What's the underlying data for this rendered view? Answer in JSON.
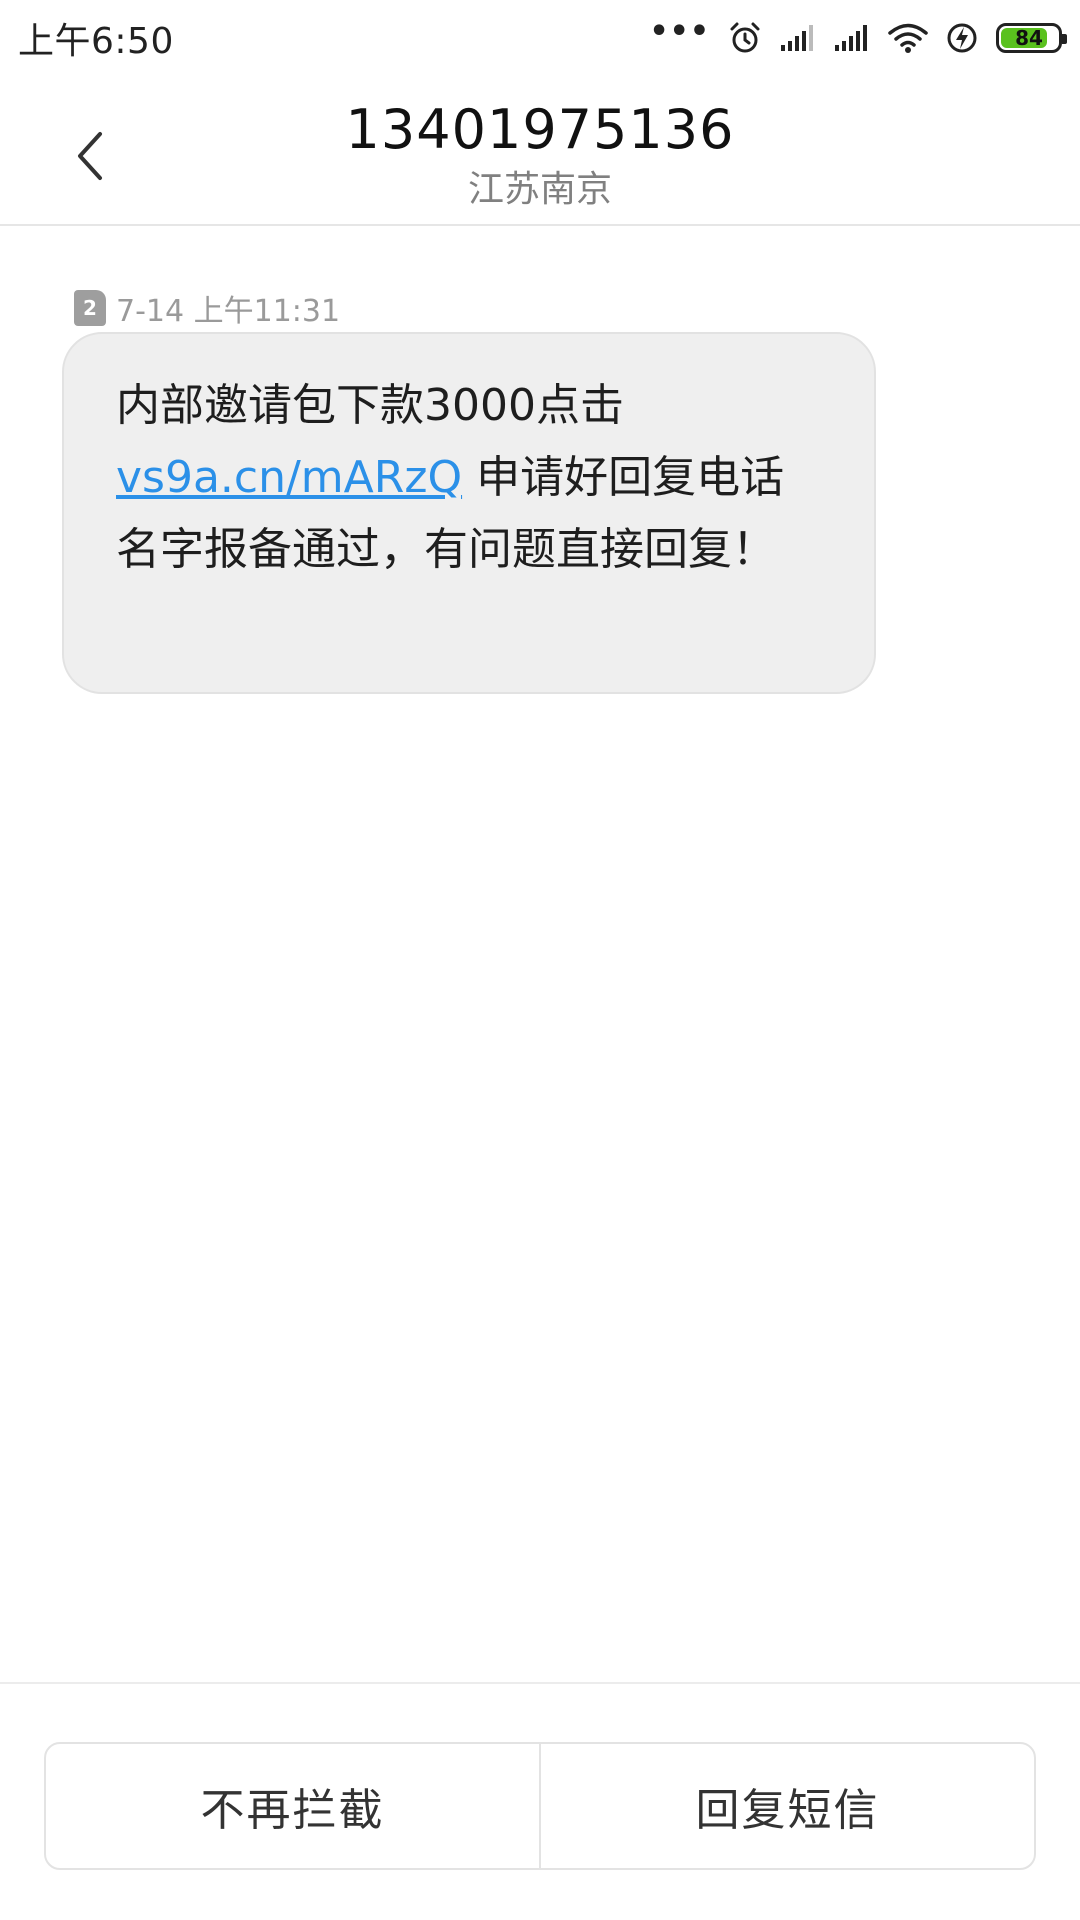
{
  "status_bar": {
    "time": "上午6:50",
    "battery_level": "84",
    "battery_color": "#5ac11e",
    "icons": [
      "more-dots-icon",
      "alarm-icon",
      "signal-1-icon",
      "signal-2-icon",
      "wifi-icon",
      "charging-icon",
      "battery-icon"
    ]
  },
  "header": {
    "back_icon": "chevron-left-icon",
    "title": "13401975136",
    "subtitle": "江苏南京"
  },
  "message": {
    "sim_slot": "2",
    "timestamp": "7-14 上午11:31",
    "text_before_link": "内部邀请包下款3000点击",
    "link": "vs9a.cn/mARzQ",
    "text_after_link": " 申请好回复电话名字报备通过，有问题直接回复！",
    "link_color": "#2b90e8"
  },
  "actions": {
    "unblock_label": "不再拦截",
    "reply_label": "回复短信"
  }
}
